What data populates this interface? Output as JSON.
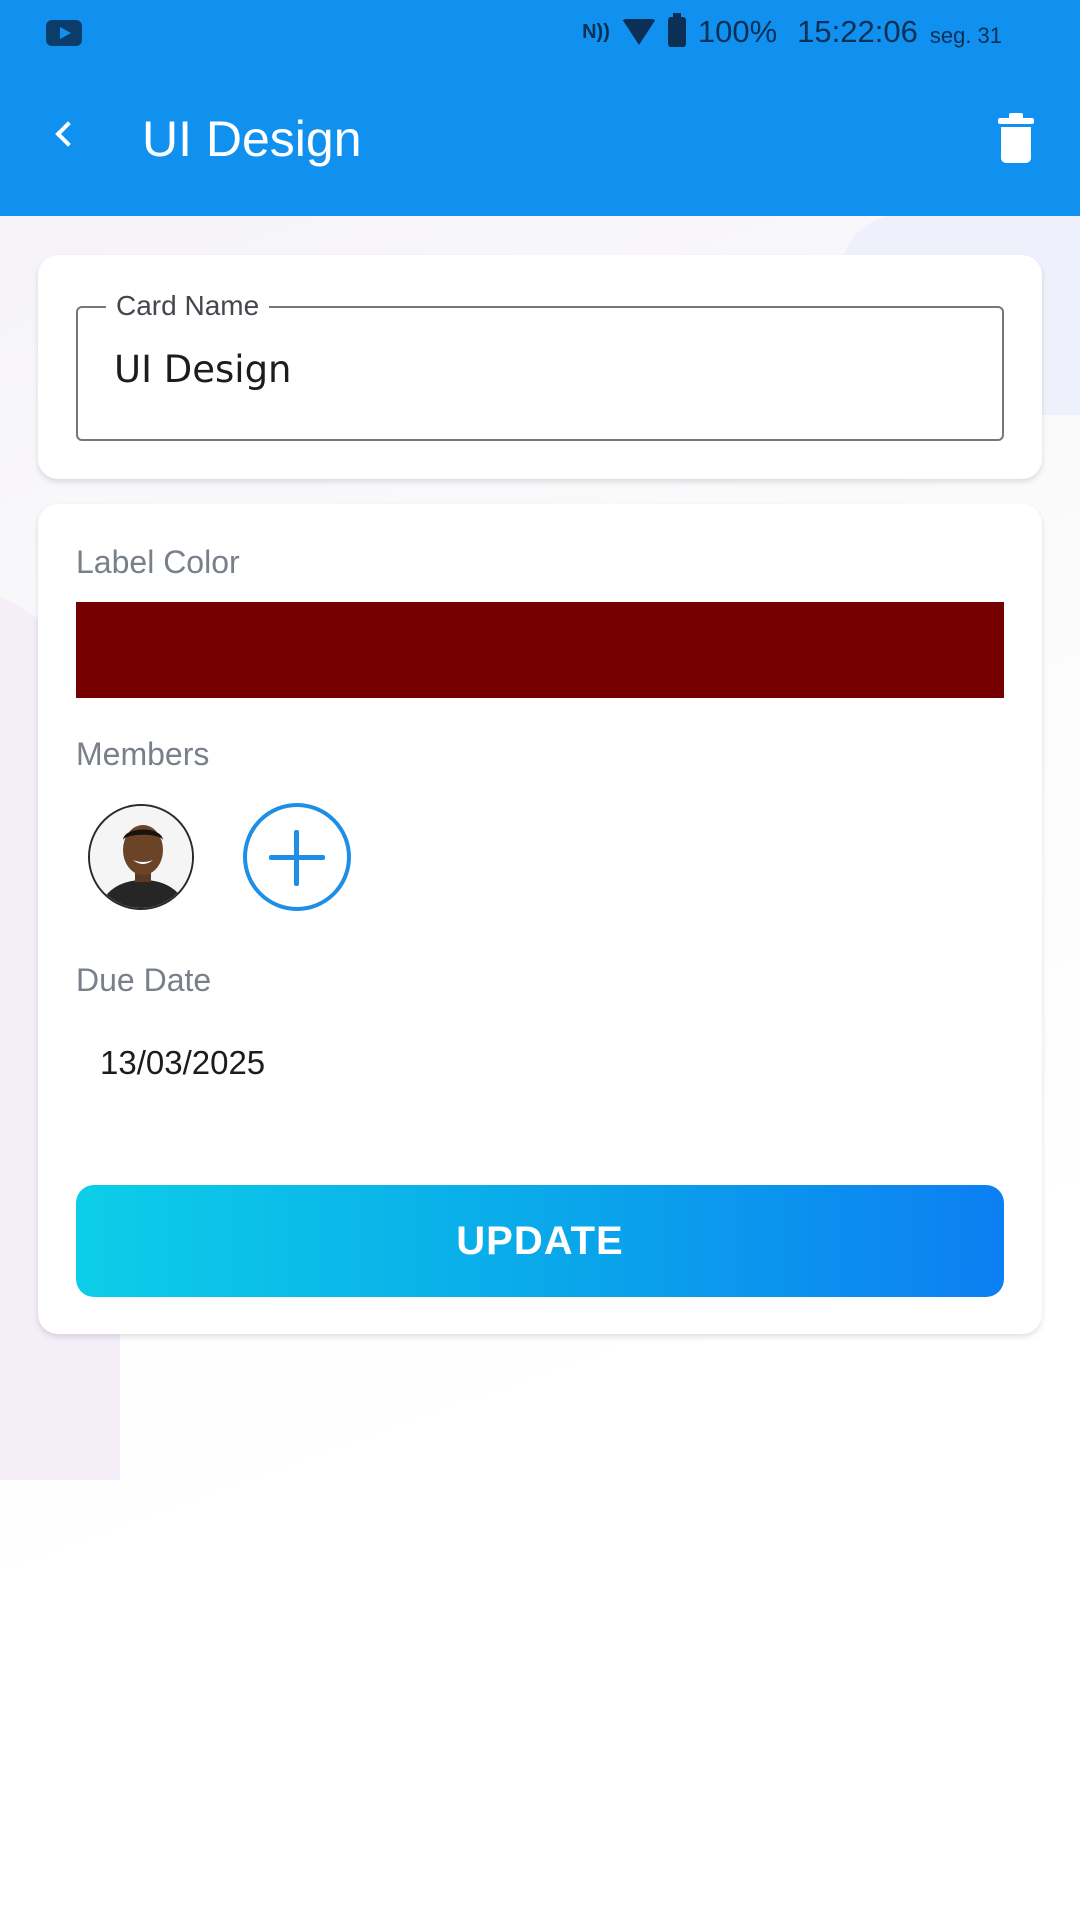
{
  "status_bar": {
    "nfc": "N))",
    "battery": "100%",
    "time": "15:22:06",
    "day": "seg. 31"
  },
  "toolbar": {
    "title": "UI Design"
  },
  "card_name": {
    "label": "Card Name",
    "value": "UI Design"
  },
  "details": {
    "label_color_title": "Label Color",
    "label_color": "#760000",
    "members_title": "Members",
    "due_date_title": "Due Date",
    "due_date": "13/03/2025",
    "update_label": "UPDATE"
  },
  "colors": {
    "app_bar": "#1191ef",
    "accent": "#1f8fe6"
  }
}
